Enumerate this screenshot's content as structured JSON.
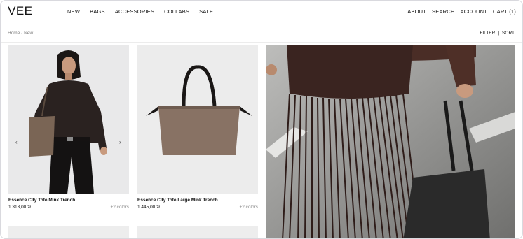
{
  "brand": {
    "logo": "VEE"
  },
  "nav": {
    "left": [
      "NEW",
      "BAGS",
      "ACCESSORIES",
      "COLLABS",
      "SALE"
    ],
    "right": [
      "ABOUT",
      "SEARCH",
      "ACCOUNT",
      "CART (1)"
    ]
  },
  "breadcrumb": {
    "home": "Home",
    "separator": "/",
    "current": "New"
  },
  "toolbar": {
    "filter": "FILTER",
    "divider": "|",
    "sort": "SORT"
  },
  "products": [
    {
      "name": "Essence City Tote Mink Trench",
      "price": "1.313,00 zł",
      "colors": "+2 colors",
      "prev": "‹",
      "next": "›"
    },
    {
      "name": "Essence City Tote Large Mink Trench",
      "price": "1.445,00 zł",
      "colors": "+2 colors"
    }
  ],
  "colors": {
    "accent": "#111111",
    "muted": "#8a8a8a",
    "card_bg": "#ececec"
  }
}
